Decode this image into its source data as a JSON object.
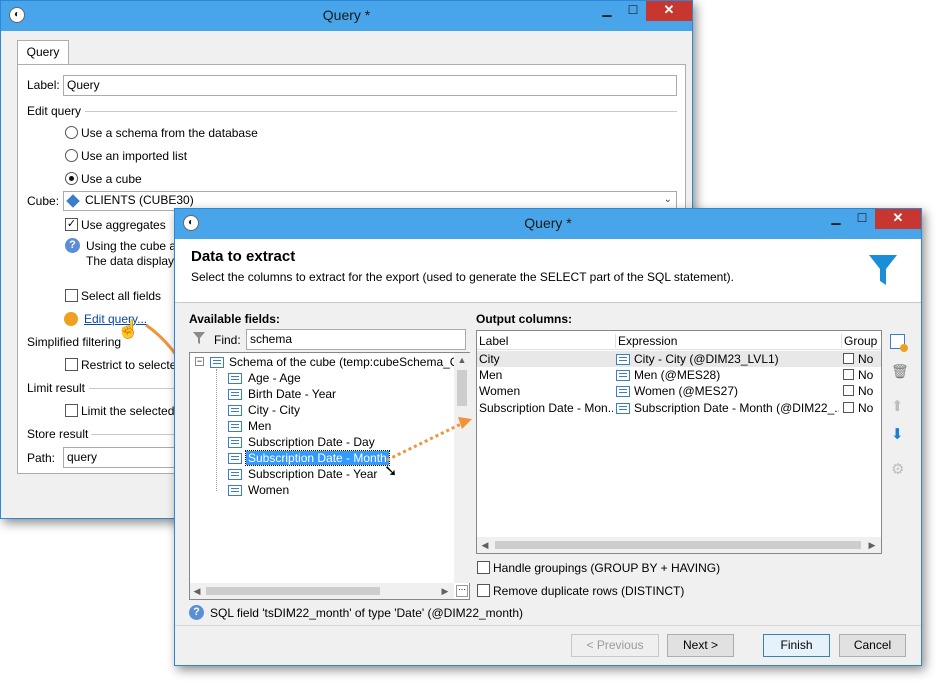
{
  "back": {
    "title": "Query *",
    "tab": "Query",
    "label_caption": "Label:",
    "label_value": "Query",
    "edit_query_section": "Edit query",
    "radio_schema": "Use a schema from the database",
    "radio_imported": "Use an imported list",
    "radio_cube": "Use a cube",
    "cube_caption": "Cube:",
    "cube_value": "CLIENTS (CUBE30)",
    "use_aggregates": "Use aggregates",
    "info_line1": "Using the cube a",
    "info_line2": "The data display",
    "select_all": "Select all fields",
    "edit_query_link": "Edit query...",
    "simplified_section": "Simplified filtering",
    "restrict": "Restrict to selecte",
    "limit_section": "Limit result",
    "limit_selected": "Limit the selected",
    "store_section": "Store result",
    "path_caption": "Path:",
    "path_value": "query"
  },
  "front": {
    "title": "Query *",
    "header_title": "Data to extract",
    "header_desc": "Select the columns to extract for the export (used to generate the SELECT part of the SQL statement).",
    "available_caption": "Available fields:",
    "find_caption": "Find:",
    "find_value": "schema",
    "tree_root": "Schema of the cube (temp:cubeSchema_Cl",
    "tree_items": [
      "Age - Age",
      "Birth Date - Year",
      "City - City",
      "Men",
      "Subscription Date - Day",
      "Subscription Date - Month",
      "Subscription Date - Year",
      "Women"
    ],
    "output_caption": "Output columns:",
    "columns": [
      "Label",
      "Expression",
      "Group"
    ],
    "rows": [
      {
        "label": "City",
        "expression": "City - City (@DIM23_LVL1)",
        "group": "No"
      },
      {
        "label": "Men",
        "expression": "Men (@MES28)",
        "group": "No"
      },
      {
        "label": "Women",
        "expression": "Women (@MES27)",
        "group": "No"
      },
      {
        "label": "Subscription Date - Mon...",
        "expression": "Subscription Date - Month (@DIM22_...",
        "group": "No"
      }
    ],
    "handle_groupings": "Handle groupings (GROUP BY + HAVING)",
    "remove_duplicates": "Remove duplicate rows (DISTINCT)",
    "sql_info": "SQL field 'tsDIM22_month' of type 'Date' (@DIM22_month)",
    "btn_previous": "< Previous",
    "btn_next": "Next >",
    "btn_finish": "Finish",
    "btn_cancel": "Cancel"
  },
  "colors": {
    "titlebar": "#48a5ea",
    "close": "#c7372f",
    "selection": "#3399ff",
    "arrow": "#f0943a",
    "accent": "#1a8fd8"
  }
}
